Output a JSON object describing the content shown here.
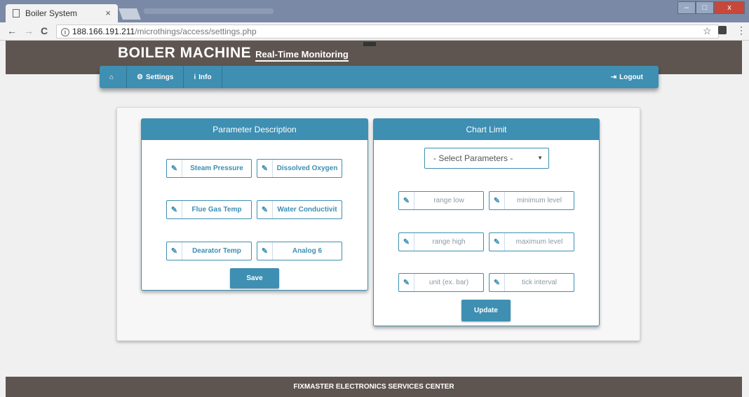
{
  "browser": {
    "tab_title": "Boiler System",
    "tab_close": "×",
    "url_host": "188.166.191.211",
    "url_path": "/microthings/access/settings.php",
    "back": "←",
    "forward": "→",
    "reload": "C",
    "info_badge": "i",
    "star": "☆",
    "menu": "⋮",
    "win_min": "–",
    "win_max": "□",
    "win_close": "x"
  },
  "header": {
    "brand_main": "BOILER MACHINE",
    "brand_sub": "Real-Time Monitoring"
  },
  "nav": {
    "home_icon": "⌂",
    "settings_icon": "⚙",
    "settings_label": "Settings",
    "info_icon": "i",
    "info_label": "Info",
    "logout_icon": "⇥",
    "logout_label": "Logout"
  },
  "param_card": {
    "title": "Parameter Description",
    "fields": [
      "Steam Pressure",
      "Dissolved Oxygen",
      "Flue Gas Temp",
      "Water Conductivit",
      "Dearator Temp",
      "Analog 6"
    ],
    "save_label": "Save"
  },
  "chart_card": {
    "title": "Chart Limit",
    "select_value": "- Select Parameters -",
    "select_caret": "▼",
    "fields": [
      "range low",
      "minimum level",
      "range high",
      "maximum level",
      "unit (ex. bar)",
      "tick interval"
    ],
    "update_label": "Update"
  },
  "footer": {
    "text": "FIXMASTER ELECTRONICS SERVICES CENTER"
  },
  "colors": {
    "accent": "#3e8fb2",
    "header_bg": "#5f5550"
  },
  "icons": {
    "field_icon": "✎"
  }
}
